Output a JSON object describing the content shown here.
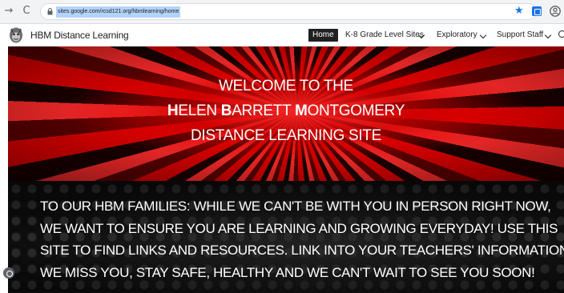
{
  "browser": {
    "back_glyph": "→",
    "reload_glyph": "C",
    "url": "sites.google.com/rcsd121.org/hbmlearning/home",
    "bookmark_glyph": "★"
  },
  "site": {
    "title": "HBM Distance Learning",
    "nav": [
      {
        "label": "Home",
        "active": true
      },
      {
        "label": "K-8 Grade Level Sites",
        "has_dropdown": true
      },
      {
        "label": "Exploratory",
        "has_dropdown": true
      },
      {
        "label": "Support Staff",
        "has_dropdown": true
      }
    ]
  },
  "hero": {
    "line1": "WELCOME TO THE",
    "line2": {
      "i1": "H",
      "r1": "ELEN ",
      "i2": "B",
      "r2": "ARRETT ",
      "i3": "M",
      "r3": "ONTGOMERY"
    },
    "line3": "DISTANCE LEARNING SITE"
  },
  "message": {
    "lines": [
      "TO OUR HBM FAMILIES:  WHILE WE CAN'T BE WITH YOU IN PERSON RIGHT NOW,",
      "WE WANT TO ENSURE YOU ARE LEARNING AND GROWING EVERYDAY! USE THIS",
      "SITE TO FIND LINKS AND RESOURCES. LINK INTO YOUR TEACHERS' INFORMATION.",
      "WE MISS YOU, STAY SAFE, HEALTHY AND WE CAN'T WAIT TO SEE YOU SOON!"
    ]
  },
  "colors": {
    "nav_active_bg": "#212121",
    "hero_red": "#e00000",
    "url_highlight": "#b3d4fc"
  }
}
